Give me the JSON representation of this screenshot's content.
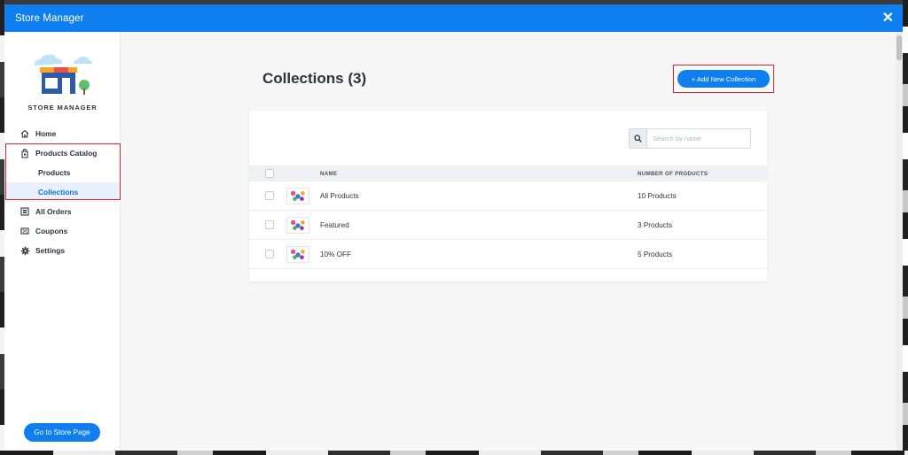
{
  "window": {
    "title": "Store Manager"
  },
  "sidebar": {
    "logo_text": "STORE MANAGER",
    "items": [
      {
        "label": "Home",
        "icon": "home-icon"
      },
      {
        "label": "Products Catalog",
        "icon": "catalog-icon"
      },
      {
        "label": "Products",
        "sub": true
      },
      {
        "label": "Collections",
        "sub": true,
        "active": true
      },
      {
        "label": "All Orders",
        "icon": "orders-icon"
      },
      {
        "label": "Coupons",
        "icon": "coupon-icon"
      },
      {
        "label": "Settings",
        "icon": "gear-icon"
      }
    ],
    "store_button": "Go to Store Page"
  },
  "main": {
    "title": "Collections (3)",
    "add_button": "+ Add New Collection",
    "search": {
      "placeholder": "Search by name",
      "value": ""
    },
    "table": {
      "columns": [
        "NAME",
        "NUMBER OF PRODUCTS"
      ],
      "rows": [
        {
          "name": "All Products",
          "count": "10 Products"
        },
        {
          "name": "Featured",
          "count": "3 Products"
        },
        {
          "name": "10% OFF",
          "count": "5 Products"
        }
      ]
    }
  },
  "colors": {
    "accent": "#0f7ff0",
    "highlight_box": "#d8262b",
    "active_bg": "#e6f1fd"
  }
}
